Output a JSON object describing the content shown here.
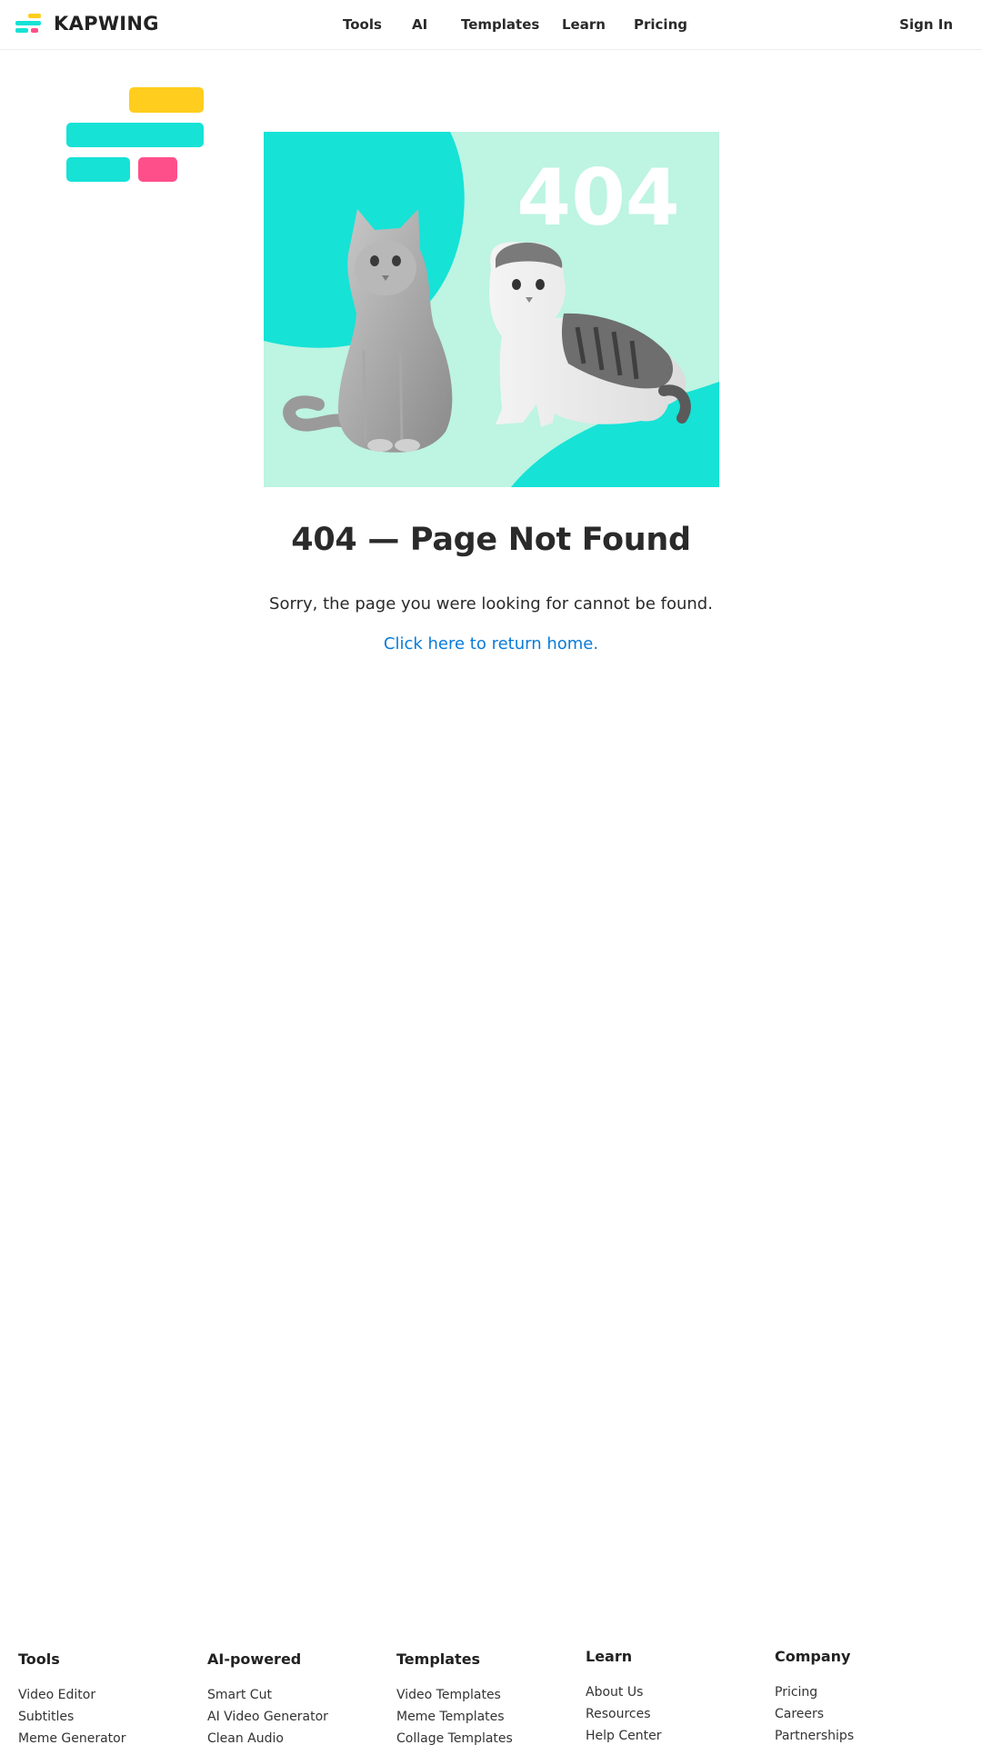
{
  "brand": {
    "name": "KAPWING",
    "colors": {
      "teal": "#16e2d6",
      "yellow": "#ffcd1e",
      "pink": "#ff4f8b",
      "mint": "#bdf4e2"
    }
  },
  "nav": {
    "items": [
      {
        "label": "Tools"
      },
      {
        "label": "AI"
      },
      {
        "label": "Templates"
      },
      {
        "label": "Learn"
      },
      {
        "label": "Pricing"
      }
    ],
    "sign_in": "Sign In"
  },
  "error": {
    "illustration_text": "404",
    "title": "404 — Page Not Found",
    "message": "Sorry, the page you were looking for cannot be found.",
    "home_link": "Click here to return home."
  },
  "footer": {
    "columns": [
      {
        "heading": "Tools",
        "links": [
          "Video Editor",
          "Subtitles",
          "Meme Generator"
        ]
      },
      {
        "heading": "AI-powered",
        "links": [
          "Smart Cut",
          "AI Video Generator",
          "Clean Audio"
        ]
      },
      {
        "heading": "Templates",
        "links": [
          "Video Templates",
          "Meme Templates",
          "Collage Templates"
        ]
      },
      {
        "heading": "Learn",
        "links": [
          "About Us",
          "Resources",
          "Help Center"
        ]
      },
      {
        "heading": "Company",
        "links": [
          "Pricing",
          "Careers",
          "Partnerships"
        ]
      }
    ]
  }
}
